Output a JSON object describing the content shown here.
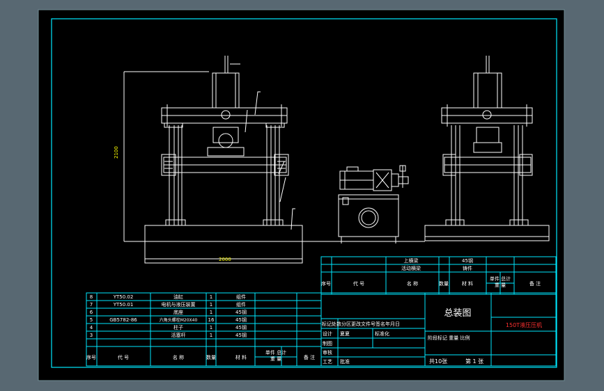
{
  "colors": {
    "background": "#586872",
    "sheet": "#000000",
    "frame": "#00ffff",
    "drawing": "#ffffff",
    "table_text": "#ffffff",
    "title_text": "#ffff00",
    "product_name": "#ff3030"
  },
  "dimensions": {
    "height_label": "2100",
    "width_label": "2000"
  },
  "upper_parts": [
    {
      "no": "",
      "name": "上横梁",
      "qty": "",
      "material": "45钢"
    },
    {
      "no": "",
      "name": "活动横梁",
      "qty": "",
      "material": "铸件"
    }
  ],
  "upper_header": {
    "no": "序号",
    "code": "代 号",
    "name": "名 称",
    "qty": "数量",
    "material": "材 料",
    "weight": "单件 总计\n重 量",
    "remark": "备 注"
  },
  "parts": [
    {
      "no": "8",
      "code": "YT50.02",
      "name": "油缸",
      "qty": "1",
      "material": "组件"
    },
    {
      "no": "7",
      "code": "YT50.01",
      "name": "电机与液压装置",
      "qty": "1",
      "material": "组件"
    },
    {
      "no": "6",
      "code": "",
      "name": "底座",
      "qty": "1",
      "material": "45钢"
    },
    {
      "no": "5",
      "code": "GB5782-86",
      "name": "六角头螺栓M20X40",
      "qty": "16",
      "material": "45钢"
    },
    {
      "no": "4",
      "code": "",
      "name": "柱子",
      "qty": "1",
      "material": "45钢"
    },
    {
      "no": "3",
      "code": "",
      "name": "活塞杆",
      "qty": "1",
      "material": "45钢"
    }
  ],
  "lower_header": {
    "no": "序号",
    "code": "代 号",
    "name": "名 称",
    "qty": "数量",
    "material": "材 料",
    "weight": "单件 总计\n重 量",
    "remark": "备 注"
  },
  "title_block": {
    "drawing_title": "总装图",
    "product_name": "150T液压压机",
    "revision_header": "标记处数分区更改文件号签名年月日",
    "design": "设计",
    "designer": "夏夏",
    "standardize": "标准化",
    "drafting": "制图",
    "review": "审核",
    "process": "工艺",
    "approve": "批准",
    "stage_header": "阶段标记 重量 比例",
    "sheet_total": "共10张",
    "sheet_no": "第 1 张"
  }
}
